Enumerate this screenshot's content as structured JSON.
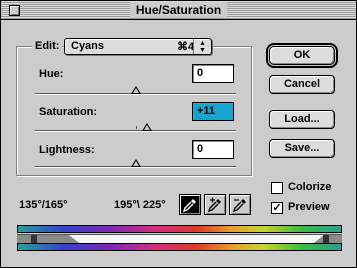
{
  "window": {
    "title": "Hue/Saturation"
  },
  "edit": {
    "label": "Edit:",
    "selected": "Cyans",
    "shortcut": "⌘4"
  },
  "sliders": [
    {
      "label": "Hue:",
      "value": "0",
      "fraction": 0.5
    },
    {
      "label": "Saturation:",
      "value": "+11",
      "fraction": 0.555
    },
    {
      "label": "Lightness:",
      "value": "0",
      "fraction": 0.5
    }
  ],
  "buttons": {
    "ok": "OK",
    "cancel": "Cancel",
    "load": "Load...",
    "save": "Save..."
  },
  "checkboxes": {
    "colorize": {
      "label": "Colorize",
      "checked": false
    },
    "preview": {
      "label": "Preview",
      "checked": true
    }
  },
  "ranges": {
    "outer": "135°/165°",
    "inner": "195°\\ 225°"
  },
  "tools": [
    {
      "name": "eyedropper-icon",
      "active": true
    },
    {
      "name": "eyedropper-plus-icon",
      "active": false
    },
    {
      "name": "eyedropper-minus-icon",
      "active": false
    }
  ],
  "colors": {
    "selection": "#16a3ce",
    "background": "#cccccc"
  }
}
